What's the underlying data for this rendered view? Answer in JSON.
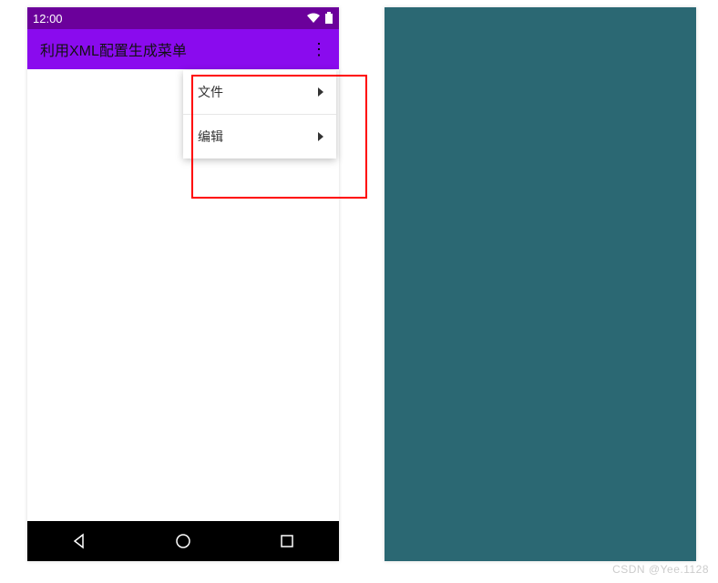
{
  "status": {
    "time": "12:00"
  },
  "appbar": {
    "title": "利用XML配置生成菜单"
  },
  "menu": {
    "items": [
      {
        "label": "文件"
      },
      {
        "label": "编辑"
      }
    ]
  },
  "watermark": "CSDN @Yee.1128",
  "colors": {
    "statusBar": "#6b009b",
    "appBar": "#8a0bee",
    "rightPane": "#2b6873",
    "highlight": "#ff0000"
  }
}
